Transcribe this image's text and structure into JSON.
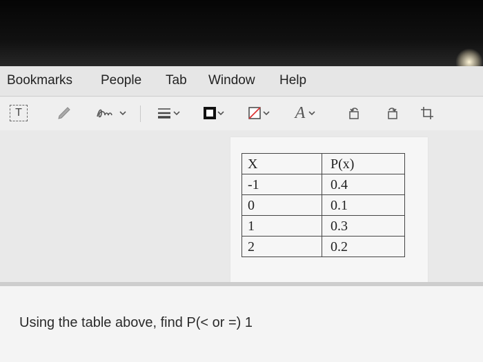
{
  "menu": {
    "items": [
      "Bookmarks",
      "People",
      "Tab",
      "Window",
      "Help"
    ]
  },
  "toolbar": {
    "text_tool_label": "T",
    "font_tool_label": "A"
  },
  "table": {
    "headers": [
      "X",
      "P(x)"
    ],
    "rows": [
      [
        "-1",
        "0.4"
      ],
      [
        "0",
        "0.1"
      ],
      [
        "1",
        "0.3"
      ],
      [
        "2",
        "0.2"
      ]
    ]
  },
  "question": {
    "text": "Using the table above, find P(< or =) 1"
  },
  "colors": {
    "screen_bg": "#ebebeb",
    "text": "#222222"
  }
}
